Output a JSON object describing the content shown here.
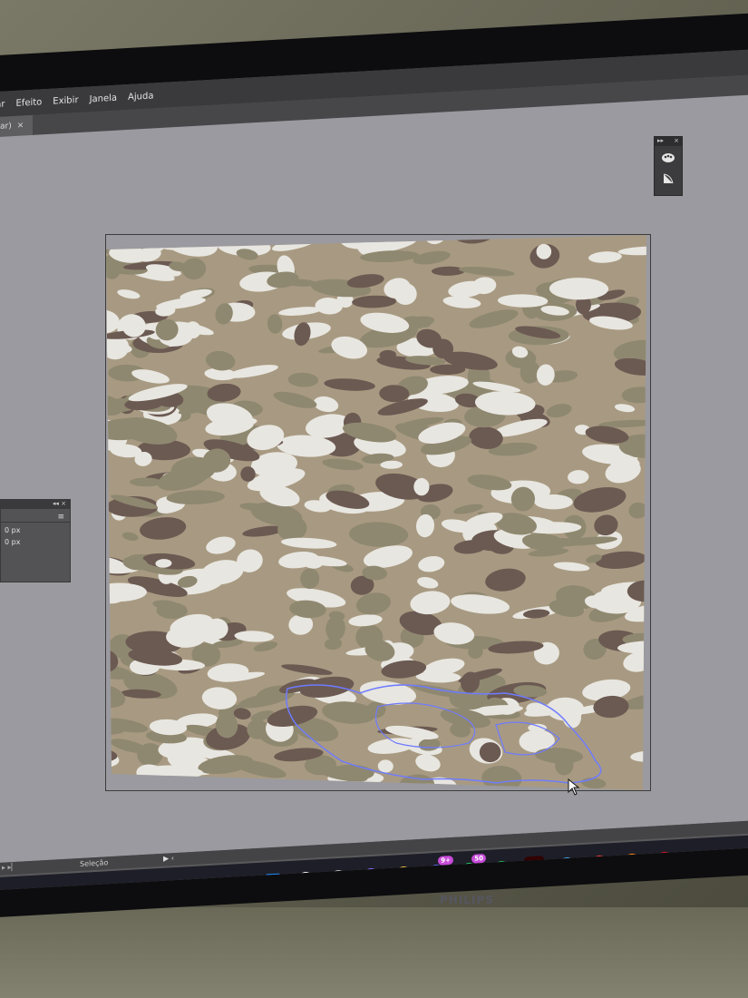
{
  "menu": {
    "items": [
      "ionar",
      "Efeito",
      "Exibir",
      "Janela",
      "Ajuda"
    ]
  },
  "document_tab": {
    "label": "ar)",
    "close_glyph": "×"
  },
  "tool_panel": {
    "header_left": "▸▸",
    "header_right": "×",
    "icons": [
      "palette-icon",
      "shape-tool-icon"
    ]
  },
  "left_panel": {
    "header": "◂◂ ×",
    "menu_glyph": "≡",
    "fields": [
      "0 px",
      "0 px"
    ]
  },
  "status_bar": {
    "left": "▸ ▸▏",
    "text": "Seleção",
    "arrows": "▶ ‹"
  },
  "taskbar": {
    "icons": [
      {
        "name": "windows-start-icon",
        "label": "",
        "color": "#1f8fff"
      },
      {
        "name": "search-icon",
        "label": "",
        "color": "#ffffff"
      },
      {
        "name": "task-view-icon",
        "label": "",
        "color": "#bdbdbd"
      },
      {
        "name": "copilot-icon",
        "label": "",
        "color": "#8c6bff"
      },
      {
        "name": "file-explorer-icon",
        "label": "",
        "color": "#f4c242"
      },
      {
        "name": "discord-icon",
        "label": "",
        "color": "#5865f2",
        "badge": "9+"
      },
      {
        "name": "whatsapp-icon",
        "label": "",
        "color": "#25d366",
        "badge": "50"
      },
      {
        "name": "spotify-icon",
        "label": "",
        "color": "#1db954"
      },
      {
        "name": "illustrator-icon",
        "label": "Ai",
        "color": "#330000",
        "active": true
      },
      {
        "name": "notepad-icon",
        "label": "",
        "color": "#4aa3df"
      },
      {
        "name": "chrome-icon",
        "label": "",
        "color": "#e94235"
      },
      {
        "name": "search-everything-icon",
        "label": "",
        "color": "#ff8c1a"
      },
      {
        "name": "opera-icon",
        "label": "",
        "color": "#e0162b"
      }
    ]
  },
  "brand": "PHILIPS",
  "colors": {
    "camo_light": "#e8e6e0",
    "camo_tan": "#a89a82",
    "camo_olive": "#8f8870",
    "camo_dark": "#6b5a52",
    "selection": "#6e7bff"
  }
}
